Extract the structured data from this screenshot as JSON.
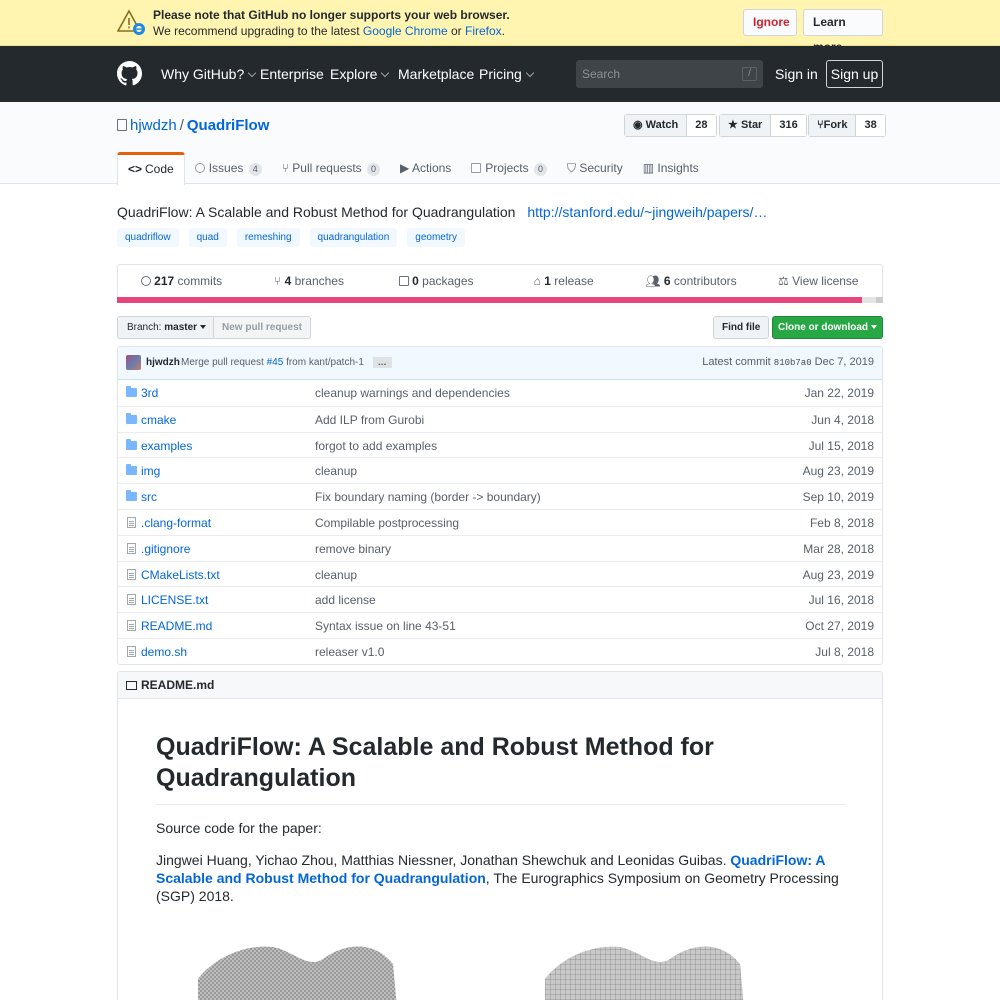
{
  "banner": {
    "title": "Please note that GitHub no longer supports your web browser.",
    "text_prefix": "We recommend upgrading to the latest",
    "chrome": "Google Chrome",
    "or": "or",
    "firefox": "Firefox",
    "period": ".",
    "ignore": "Ignore",
    "learn_more": "Learn more"
  },
  "header": {
    "nav": [
      "Why GitHub?",
      "Enterprise",
      "Explore",
      "Marketplace",
      "Pricing"
    ],
    "search_placeholder": "Search",
    "search_shortcut": "/",
    "sign_in": "Sign in",
    "sign_up": "Sign up"
  },
  "repo": {
    "owner": "hjwdzh",
    "separator": "/",
    "name": "QuadriFlow",
    "watch": {
      "label": "Watch",
      "count": "28"
    },
    "star": {
      "label": "Star",
      "count": "316"
    },
    "fork": {
      "label": "Fork",
      "count": "38"
    }
  },
  "tabs": [
    {
      "label": "Code"
    },
    {
      "label": "Issues",
      "count": "4"
    },
    {
      "label": "Pull requests",
      "count": "0"
    },
    {
      "label": "Actions"
    },
    {
      "label": "Projects",
      "count": "0"
    },
    {
      "label": "Security"
    },
    {
      "label": "Insights"
    }
  ],
  "about": {
    "description": "QuadriFlow: A Scalable and Robust Method for Quadrangulation",
    "homepage": "http://stanford.edu/~jingweih/papers/…",
    "topics": [
      "quadriflow",
      "quad",
      "remeshing",
      "quadrangulation",
      "geometry"
    ]
  },
  "summary": {
    "commits": {
      "count": "217",
      "label": "commits"
    },
    "branches": {
      "count": "4",
      "label": "branches"
    },
    "packages": {
      "count": "0",
      "label": "packages"
    },
    "releases": {
      "count": "1",
      "label": "release"
    },
    "contributors": {
      "count": "6",
      "label": "contributors"
    },
    "license": "View license"
  },
  "language_colors": [
    "#e6467c",
    "#e4e4e4",
    "#cccccc"
  ],
  "file_nav": {
    "branch_prefix": "Branch:",
    "branch": "master",
    "new_pr": "New pull request",
    "find_file": "Find file",
    "clone": "Clone or download"
  },
  "latest_commit": {
    "author": "hjwdzh",
    "message_prefix": "Merge pull request",
    "pr": "#45",
    "message_suffix": "from kant/patch-1",
    "more": "…",
    "label": "Latest commit",
    "sha": "810b7a0",
    "date": "Dec 7, 2019"
  },
  "files": [
    {
      "type": "dir",
      "name": "3rd",
      "message": "cleanup warnings and dependencies",
      "age": "Jan 22, 2019"
    },
    {
      "type": "dir",
      "name": "cmake",
      "message": "Add ILP from Gurobi",
      "age": "Jun 4, 2018"
    },
    {
      "type": "dir",
      "name": "examples",
      "message": "forgot to add examples",
      "age": "Jul 15, 2018"
    },
    {
      "type": "dir",
      "name": "img",
      "message": "cleanup",
      "age": "Aug 23, 2019"
    },
    {
      "type": "dir",
      "name": "src",
      "message": "Fix boundary naming (border -> boundary)",
      "age": "Sep 10, 2019"
    },
    {
      "type": "file",
      "name": ".clang-format",
      "message": "Compilable postprocessing",
      "age": "Feb 8, 2018"
    },
    {
      "type": "file",
      "name": ".gitignore",
      "message": "remove binary",
      "age": "Mar 28, 2018"
    },
    {
      "type": "file",
      "name": "CMakeLists.txt",
      "message": "cleanup",
      "age": "Aug 23, 2019"
    },
    {
      "type": "file",
      "name": "LICENSE.txt",
      "message": "add license",
      "age": "Jul 16, 2018"
    },
    {
      "type": "file",
      "name": "README.md",
      "message": "Syntax issue on line 43-51",
      "age": "Oct 27, 2019"
    },
    {
      "type": "file",
      "name": "demo.sh",
      "message": "releaser v1.0",
      "age": "Jul 8, 2018"
    }
  ],
  "readme": {
    "filename": "README.md",
    "heading": "QuadriFlow: A Scalable and Robust Method for Quadrangulation",
    "intro": "Source code for the paper:",
    "authors": "Jingwei Huang, Yichao Zhou, Matthias Niessner, Jonathan Shewchuk and Leonidas Guibas.",
    "paper_link": "QuadriFlow: A Scalable and Robust Method for Quadrangulation",
    "venue": ", The Eurographics Symposium on Geometry Processing (SGP) 2018."
  }
}
